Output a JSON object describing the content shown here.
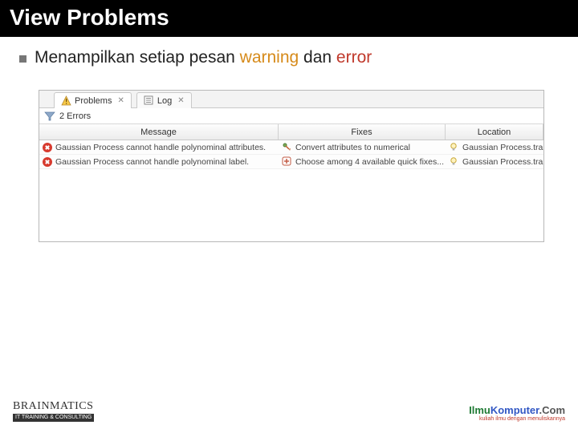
{
  "slide": {
    "title": "View Problems",
    "bullet_prefix": "Menampilkan setiap pesan ",
    "bullet_warning": "warning",
    "bullet_and": " dan ",
    "bullet_error": "error"
  },
  "panel": {
    "tabs": {
      "problems": "Problems",
      "log": "Log"
    },
    "status": "2 Errors",
    "columns": {
      "message": "Message",
      "fixes": "Fixes",
      "location": "Location"
    },
    "rows": [
      {
        "message": "Gaussian Process cannot handle polynominal attributes.",
        "fix": "Convert attributes to numerical",
        "location": "Gaussian Process.training set"
      },
      {
        "message": "Gaussian Process cannot handle polynominal label.",
        "fix": "Choose among 4 available quick fixes...",
        "location": "Gaussian Process.training set"
      }
    ]
  },
  "footer": {
    "left_brand": "BRAINMATICS",
    "left_strap": "IT TRAINING & CONSULTING",
    "right_brand_a": "Ilmu",
    "right_brand_b": "Komputer",
    "right_brand_c": ".Com",
    "right_tag": "kuliah ilmu dengan menuliskannya"
  }
}
